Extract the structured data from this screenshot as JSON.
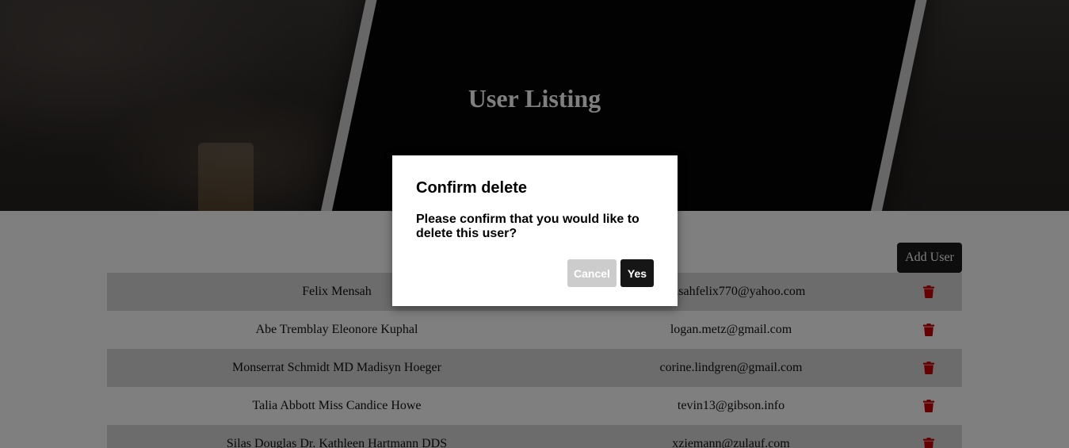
{
  "header": {
    "title": "User Listing"
  },
  "toolbar": {
    "add_user_label": "Add User"
  },
  "users": [
    {
      "name": "Felix Mensah",
      "email": "mensahfelix770@yahoo.com"
    },
    {
      "name": "Abe Tremblay Eleonore Kuphal",
      "email": "logan.metz@gmail.com"
    },
    {
      "name": "Monserrat Schmidt MD Madisyn Hoeger",
      "email": "corine.lindgren@gmail.com"
    },
    {
      "name": "Talia Abbott Miss Candice Howe",
      "email": "tevin13@gibson.info"
    },
    {
      "name": "Silas Douglas Dr. Kathleen Hartmann DDS",
      "email": "xziemann@zulauf.com"
    }
  ],
  "icons": {
    "delete": "trash-icon"
  },
  "colors": {
    "delete_icon": "#cc0000",
    "primary_button": "#161616",
    "cancel_button": "#cccccc",
    "row_stripe": "#d9d9d9"
  },
  "modal": {
    "title": "Confirm delete",
    "message": "Please confirm that you would like to delete this user?",
    "cancel_label": "Cancel",
    "confirm_label": "Yes"
  }
}
